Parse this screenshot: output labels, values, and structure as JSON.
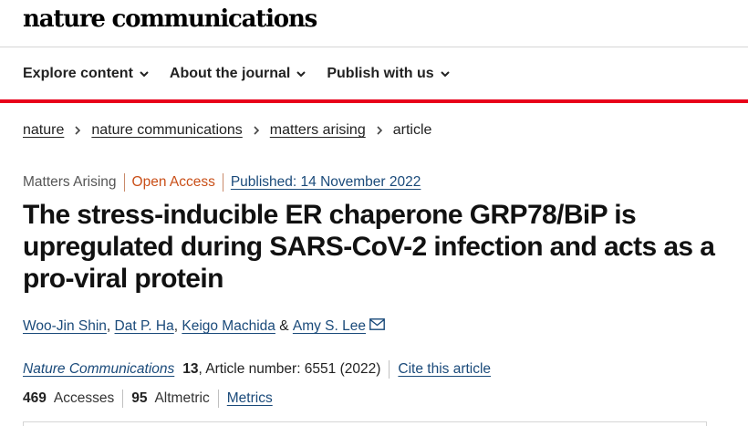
{
  "header": {
    "logo": "nature communications"
  },
  "nav": {
    "items": [
      {
        "label": "Explore content"
      },
      {
        "label": "About the journal"
      },
      {
        "label": "Publish with us"
      }
    ],
    "accent_color": "#e8001a"
  },
  "breadcrumb": {
    "items": [
      {
        "label": "nature"
      },
      {
        "label": "nature communications"
      },
      {
        "label": "matters arising"
      }
    ],
    "current": "article"
  },
  "article": {
    "type": "Matters Arising",
    "access": "Open Access",
    "published": "Published: 14 November 2022",
    "title": "The stress-inducible ER chaperone GRP78/BiP is upregulated during SARS-CoV-2 infection and acts as a pro-viral protein",
    "authors": [
      {
        "name": "Woo-Jin Shin"
      },
      {
        "name": "Dat P. Ha"
      },
      {
        "name": "Keigo Machida"
      },
      {
        "name": "Amy S. Lee"
      }
    ],
    "author_separators": [
      ",",
      ",",
      "&"
    ],
    "citation": {
      "journal": "Nature Communications",
      "volume": "13",
      "details": ", Article number: 6551 (2022)",
      "cite_link": "Cite this article"
    },
    "metrics": {
      "accesses_count": "469",
      "accesses_label": "Accesses",
      "altmetric_count": "95",
      "altmetric_label": "Altmetric",
      "metrics_link": "Metrics"
    }
  }
}
